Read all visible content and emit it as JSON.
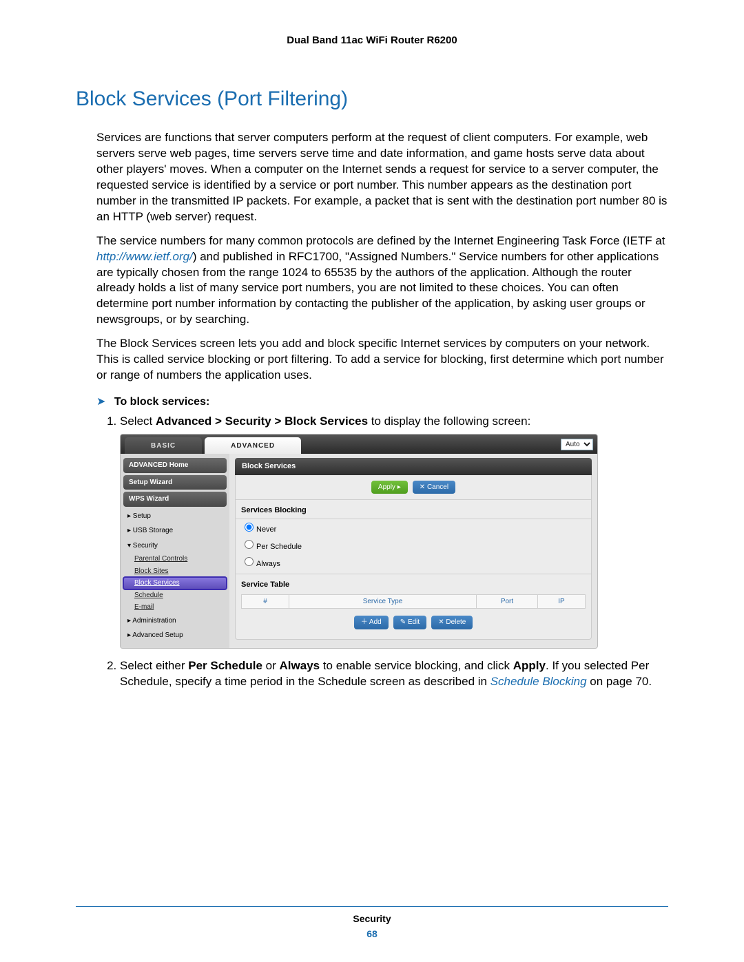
{
  "doc_header": "Dual Band 11ac WiFi Router R6200",
  "section_title": "Block Services (Port Filtering)",
  "para1": "Services are functions that server computers perform at the request of client computers. For example, web servers serve web pages, time servers serve time and date information, and game hosts serve data about other players' moves. When a computer on the Internet sends a request for service to a server computer, the requested service is identified by a service or port number. This number appears as the destination port number in the transmitted IP packets. For example, a packet that is sent with the destination port number 80 is an HTTP (web server) request.",
  "para2_a": "The service numbers for many common protocols are defined by the Internet Engineering Task Force (IETF at ",
  "para2_link": "http://www.ietf.org/",
  "para2_b": ") and published in RFC1700, \"Assigned Numbers.\" Service numbers for other applications are typically chosen from the range 1024 to 65535 by the authors of the application. Although the router already holds a list of many service port numbers, you are not limited to these choices. You can often determine port number information by contacting the publisher of the application, by asking user groups or newsgroups, or by searching.",
  "para3": "The Block Services screen lets you add and block specific Internet services by computers on your network. This is called service blocking or port filtering. To add a service for blocking, first determine which port number or range of numbers the application uses.",
  "proc_label": "To block services:",
  "step1_a": "Select ",
  "step1_b": "Advanced > Security > Block Services",
  "step1_c": "  to display the following screen:",
  "step2_a": "Select either ",
  "step2_b": "Per Schedule",
  "step2_c": " or ",
  "step2_d": "Always",
  "step2_e": " to enable service blocking, and click ",
  "step2_f": "Apply",
  "step2_g": ". If you selected Per Schedule, specify a time period in the Schedule screen as described in ",
  "step2_link": "Schedule Blocking",
  "step2_h": " on page 70.",
  "footer_section": "Security",
  "footer_page": "68",
  "ui": {
    "tabs": {
      "basic": "BASIC",
      "advanced": "ADVANCED"
    },
    "lang": "Auto",
    "sidebar": {
      "adv_home": "ADVANCED Home",
      "setup_wizard": "Setup Wizard",
      "wps_wizard": "WPS Wizard",
      "setup": "▸ Setup",
      "usb": "▸ USB Storage",
      "security": "▾ Security",
      "parental": "Parental Controls",
      "block_sites": "Block Sites",
      "block_services": "Block Services",
      "schedule": "Schedule",
      "email": "E-mail",
      "admin": "▸ Administration",
      "adv_setup": "▸ Advanced Setup"
    },
    "panel_title": "Block Services",
    "apply": "Apply ▸",
    "cancel": "✕ Cancel",
    "svc_blocking_hd": "Services Blocking",
    "radios": {
      "never": "Never",
      "per_schedule": "Per Schedule",
      "always": "Always"
    },
    "svc_table_hd": "Service Table",
    "cols": {
      "idx": "#",
      "type": "Service Type",
      "port": "Port",
      "ip": "IP"
    },
    "add": "＋ Add",
    "edit": "✎ Edit",
    "delete": "✕ Delete"
  }
}
